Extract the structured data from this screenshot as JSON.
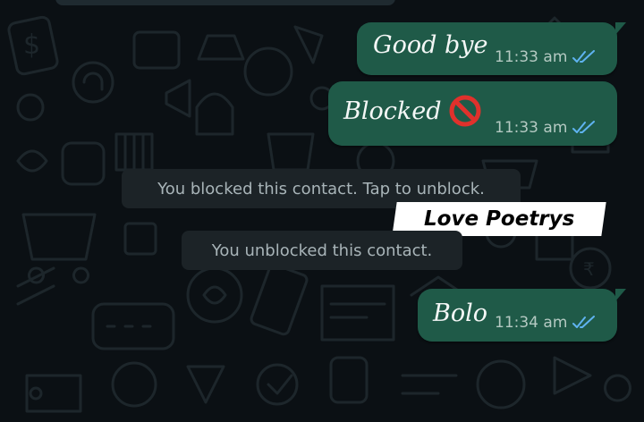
{
  "chat": {
    "messages": [
      {
        "text": "Good bye",
        "time": "11:33 am",
        "status": "read"
      },
      {
        "text": "Blocked",
        "time": "11:33 am",
        "status": "read",
        "icon": "no-entry-icon"
      },
      {
        "text": "Bolo",
        "time": "11:34 am",
        "status": "read"
      }
    ],
    "system_notices": [
      "You blocked this contact. Tap to unblock.",
      "You unblocked this contact."
    ]
  },
  "watermark": {
    "text": "Love Poetrys"
  },
  "colors": {
    "background": "#0b1014",
    "outgoing_bubble": "#1f5a48",
    "system_bubble": "#1c2327",
    "read_ticks": "#5fb3f0",
    "no_entry_red": "#e0312c"
  }
}
